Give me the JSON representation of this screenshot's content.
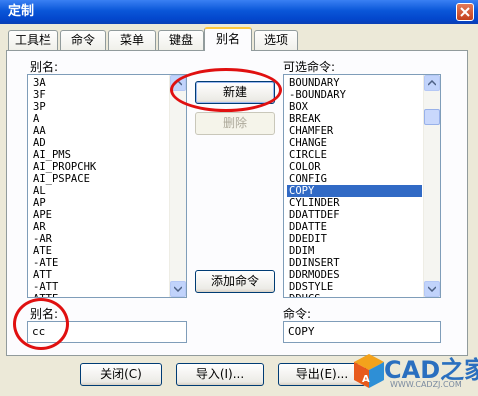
{
  "window": {
    "title": "定制"
  },
  "tabs": [
    {
      "label": "工具栏"
    },
    {
      "label": "命令"
    },
    {
      "label": "菜单"
    },
    {
      "label": "键盘"
    },
    {
      "label": "别名",
      "active": true
    },
    {
      "label": "选项"
    }
  ],
  "alias_panel": {
    "list_label": "别名:",
    "items": [
      "3A",
      "3F",
      "3P",
      "A",
      "AA",
      "AD",
      "AI_PMS",
      "AI_PROPCHK",
      "AI_PSPACE",
      "AL",
      "AP",
      "APE",
      "AR",
      "-AR",
      "ATE",
      "-ATE",
      "ATT",
      "-ATT",
      "ATTE"
    ],
    "field_label": "别名:",
    "field_value": "cc"
  },
  "command_panel": {
    "list_label": "可选命令:",
    "items": [
      "BOUNDARY",
      "-BOUNDARY",
      "BOX",
      "BREAK",
      "CHAMFER",
      "CHANGE",
      "CIRCLE",
      "COLOR",
      "CONFIG",
      "COPY",
      "CYLINDER",
      "DDATTDEF",
      "DDATTE",
      "DDEDIT",
      "DDIM",
      "DDINSERT",
      "DDRMODES",
      "DDSTYLE",
      "DDUCS"
    ],
    "selected": "COPY",
    "field_label": "命令:",
    "field_value": "COPY"
  },
  "buttons": {
    "new": "新建",
    "delete": "删除",
    "add_command": "添加命令",
    "close": "关闭(C)",
    "import": "导入(I)...",
    "export": "导出(E)..."
  },
  "watermark": {
    "text": "CAD之家",
    "url": "WWW.CADZJ.COM"
  },
  "colors": {
    "selection": "#316ac5",
    "annotation": "#e01010",
    "titlebar": "#0a56d8"
  }
}
